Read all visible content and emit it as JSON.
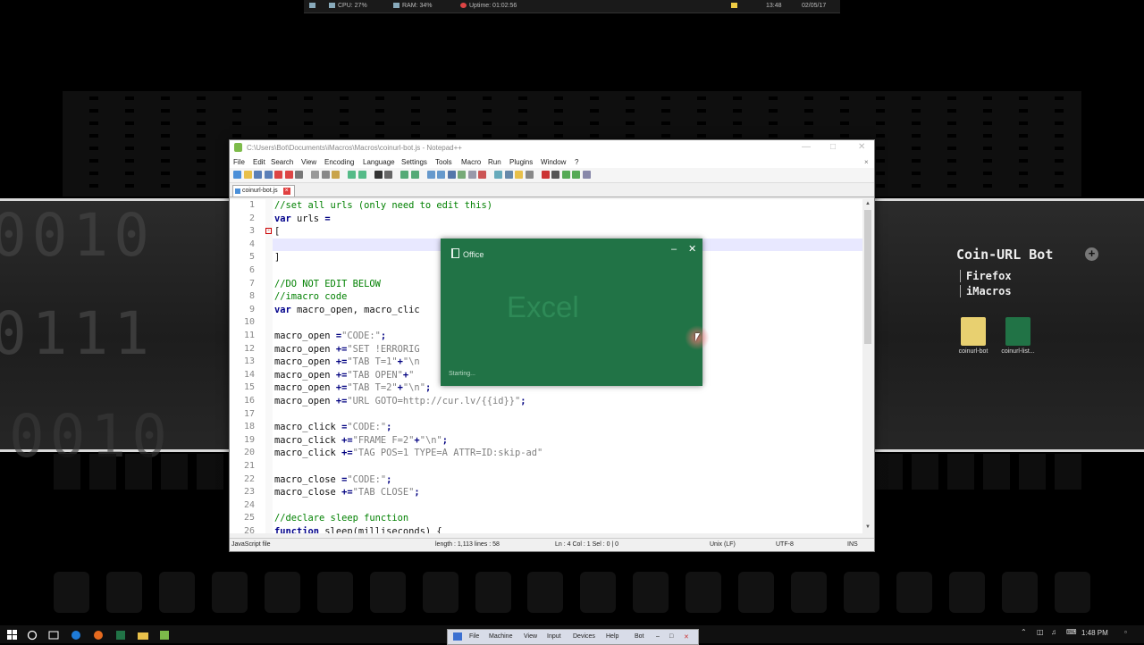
{
  "sysbar": {
    "cpu": "CPU: 27%",
    "ram": "RAM: 34%",
    "uptime": "Uptime: 01:02:56",
    "time": "13:48",
    "date": "02/05/17"
  },
  "widget": {
    "title": "Coin-URL Bot",
    "items": [
      "Firefox",
      "iMacros"
    ]
  },
  "desktop_icons": [
    {
      "label": "coinurl-bot",
      "color": "#e8d070"
    },
    {
      "label": "coinurl-list...",
      "color": "#217346"
    }
  ],
  "npp": {
    "title": "C:\\Users\\Bot\\Documents\\iMacros\\Macros\\coinurl-bot.js - Notepad++",
    "menu": [
      "File",
      "Edit",
      "Search",
      "View",
      "Encoding",
      "Language",
      "Settings",
      "Tools",
      "Macro",
      "Run",
      "Plugins",
      "Window",
      "?"
    ],
    "tab": "coinurl-bot.js",
    "lines": [
      {
        "n": "1",
        "t": "//set all urls (only need to edit this)"
      },
      {
        "n": "2",
        "t": "var urls ="
      },
      {
        "n": "3",
        "t": "["
      },
      {
        "n": "4",
        "t": ""
      },
      {
        "n": "5",
        "t": "]"
      },
      {
        "n": "6",
        "t": ""
      },
      {
        "n": "7",
        "t": "//DO NOT EDIT BELOW"
      },
      {
        "n": "8",
        "t": "//imacro code"
      },
      {
        "n": "9",
        "t": "var macro_open, macro_clic"
      },
      {
        "n": "10",
        "t": ""
      },
      {
        "n": "11",
        "t": "macro_open =\"CODE:\";"
      },
      {
        "n": "12",
        "t": "macro_open +=\"SET !ERRORIG"
      },
      {
        "n": "13",
        "t": "macro_open +=\"TAB T=1\"+\"\\n"
      },
      {
        "n": "14",
        "t": "macro_open +=\"TAB OPEN\"+\""
      },
      {
        "n": "15",
        "t": "macro_open +=\"TAB T=2\"+\"\\n\";"
      },
      {
        "n": "16",
        "t": "macro_open +=\"URL GOTO=http://cur.lv/{{id}}\";"
      },
      {
        "n": "17",
        "t": ""
      },
      {
        "n": "18",
        "t": "macro_click =\"CODE:\";"
      },
      {
        "n": "19",
        "t": "macro_click +=\"FRAME F=2\"+\"\\n\";"
      },
      {
        "n": "20",
        "t": "macro_click +=\"TAG POS=1 TYPE=A ATTR=ID:skip-ad\""
      },
      {
        "n": "21",
        "t": ""
      },
      {
        "n": "22",
        "t": "macro_close =\"CODE:\";"
      },
      {
        "n": "23",
        "t": "macro_close +=\"TAB CLOSE\";"
      },
      {
        "n": "24",
        "t": ""
      },
      {
        "n": "25",
        "t": "//declare sleep function"
      },
      {
        "n": "26",
        "t": "function sleep(milliseconds) {"
      }
    ],
    "status": {
      "filetype": "JavaScript file",
      "length": "length : 1,113    lines : 58",
      "position": "Ln : 4    Col : 1    Sel : 0 | 0",
      "eol": "Unix (LF)",
      "encoding": "UTF-8",
      "mode": "INS"
    }
  },
  "splash": {
    "brand": "Office",
    "app": "Excel",
    "status": "Starting..."
  },
  "vbox": {
    "menu": [
      "File",
      "Machine",
      "View",
      "Input",
      "Devices",
      "Help"
    ],
    "extra": "Bot"
  },
  "clock": "1:48 PM"
}
